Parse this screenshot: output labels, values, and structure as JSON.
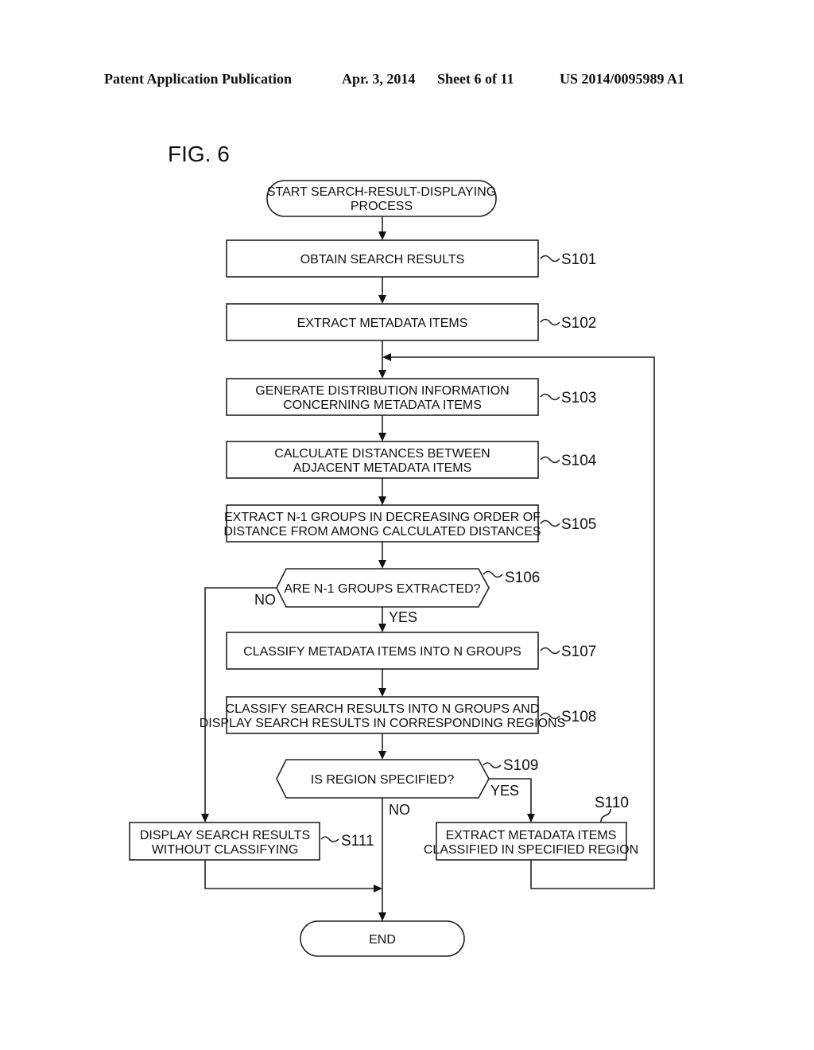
{
  "header": {
    "publication": "Patent Application Publication",
    "date": "Apr. 3, 2014",
    "sheet": "Sheet 6 of 11",
    "number": "US 2014/0095989 A1"
  },
  "figure": {
    "title": "FIG. 6"
  },
  "nodes": {
    "start": {
      "type": "terminal",
      "lines": [
        "START SEARCH-RESULT-DISPLAYING",
        "PROCESS"
      ]
    },
    "s101": {
      "type": "process",
      "step": "S101",
      "lines": [
        "OBTAIN SEARCH RESULTS"
      ]
    },
    "s102": {
      "type": "process",
      "step": "S102",
      "lines": [
        "EXTRACT METADATA ITEMS"
      ]
    },
    "s103": {
      "type": "process",
      "step": "S103",
      "lines": [
        "GENERATE DISTRIBUTION INFORMATION",
        "CONCERNING METADATA ITEMS"
      ]
    },
    "s104": {
      "type": "process",
      "step": "S104",
      "lines": [
        "CALCULATE DISTANCES BETWEEN",
        "ADJACENT METADATA ITEMS"
      ]
    },
    "s105": {
      "type": "process",
      "step": "S105",
      "lines": [
        "EXTRACT N-1 GROUPS IN DECREASING ORDER OF",
        "DISTANCE FROM AMONG CALCULATED DISTANCES"
      ]
    },
    "s106": {
      "type": "decision",
      "step": "S106",
      "lines": [
        "ARE N-1 GROUPS  EXTRACTED?"
      ]
    },
    "s107": {
      "type": "process",
      "step": "S107",
      "lines": [
        "CLASSIFY METADATA ITEMS INTO N GROUPS"
      ]
    },
    "s108": {
      "type": "process",
      "step": "S108",
      "lines": [
        "CLASSIFY SEARCH RESULTS INTO N GROUPS AND",
        "DISPLAY SEARCH RESULTS IN CORRESPONDING REGIONS"
      ]
    },
    "s109": {
      "type": "decision",
      "step": "S109",
      "lines": [
        "IS REGION SPECIFIED?"
      ]
    },
    "s110": {
      "type": "process",
      "step": "S110",
      "lines": [
        "EXTRACT METADATA ITEMS",
        "CLASSIFIED IN SPECIFIED REGION"
      ]
    },
    "s111": {
      "type": "process",
      "step": "S111",
      "lines": [
        "DISPLAY SEARCH RESULTS",
        "WITHOUT CLASSIFYING"
      ]
    },
    "end": {
      "type": "terminal",
      "lines": [
        "END"
      ]
    }
  },
  "branches": {
    "s106_no": "NO",
    "s106_yes": "YES",
    "s109_yes": "YES",
    "s109_no": "NO"
  },
  "edges": [
    {
      "from": "start",
      "to": "s101"
    },
    {
      "from": "s101",
      "to": "s102"
    },
    {
      "from": "s102",
      "to": "s103"
    },
    {
      "from": "s103",
      "to": "s104"
    },
    {
      "from": "s104",
      "to": "s105"
    },
    {
      "from": "s105",
      "to": "s106"
    },
    {
      "from": "s106",
      "to": "s107",
      "label": "YES"
    },
    {
      "from": "s106",
      "to": "s111",
      "label": "NO"
    },
    {
      "from": "s107",
      "to": "s108"
    },
    {
      "from": "s108",
      "to": "s109"
    },
    {
      "from": "s109",
      "to": "s110",
      "label": "YES"
    },
    {
      "from": "s109",
      "to": "end",
      "label": "NO"
    },
    {
      "from": "s110",
      "to": "s103"
    },
    {
      "from": "s111",
      "to": "end"
    }
  ]
}
